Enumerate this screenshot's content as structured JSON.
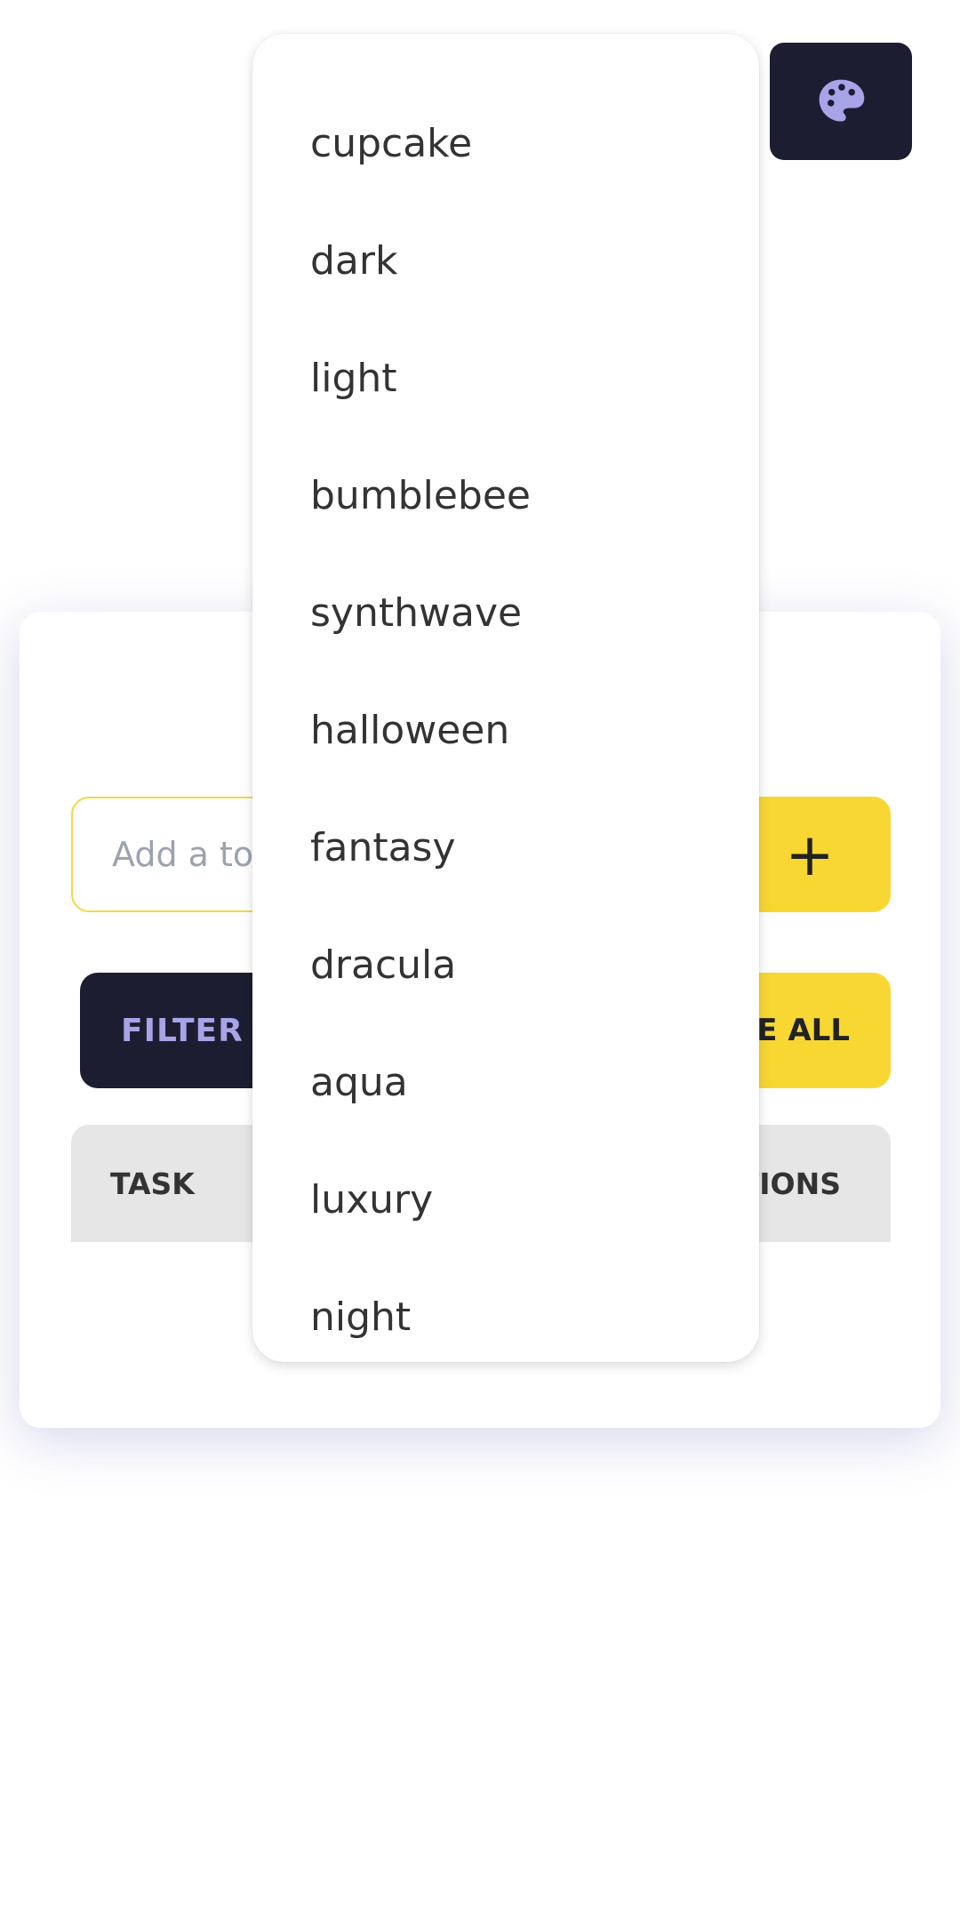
{
  "theme_button": {
    "icon": "palette-icon",
    "icon_color": "#a7a4e8",
    "bg": "#1d1d32"
  },
  "task_input": {
    "placeholder": "Add a to"
  },
  "add_button": {
    "label": "+"
  },
  "filter_button": {
    "label": "FILTER"
  },
  "delete_all_button": {
    "label": "TE ALL"
  },
  "table": {
    "headers": [
      "TASK",
      "TIONS"
    ]
  },
  "theme_menu": {
    "items": [
      "cupcake",
      "dark",
      "light",
      "bumblebee",
      "synthwave",
      "halloween",
      "fantasy",
      "dracula",
      "aqua",
      "luxury",
      "night"
    ]
  },
  "colors": {
    "accent": "#f8d733",
    "dark": "#1d1d32",
    "muted_text": "#9ca3af"
  }
}
